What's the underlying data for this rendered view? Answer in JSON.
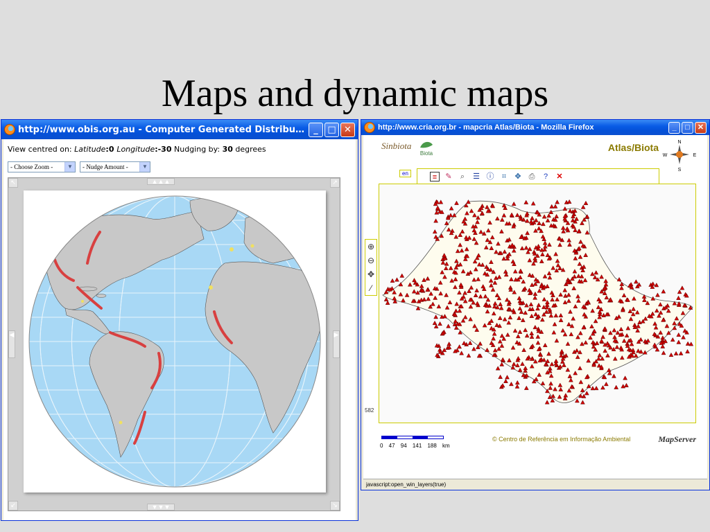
{
  "slide": {
    "title": "Maps and dynamic maps"
  },
  "window1": {
    "title": "http://www.obis.org.au - Computer Generated Distribution M...",
    "minimize": "_",
    "maximize": "□",
    "close": "✕",
    "info": {
      "prefix": "View centred on: ",
      "lat_label": "Latitude",
      "lat_value": ":0 ",
      "lon_label": "Longitude",
      "lon_value": ":-30",
      "nudge_prefix": " Nudging by: ",
      "nudge_value": "30",
      "nudge_suffix": " degrees"
    },
    "zoom_select": "- Choose Zoom -",
    "nudge_select": "- Nudge Amount -",
    "colors": {
      "ocean": "#a8d8f5",
      "land": "#c8c8c8",
      "records": "#d84040",
      "highlight": "#f0e060"
    }
  },
  "window2": {
    "title": "http://www.cria.org.br - mapcria Atlas/Biota - Mozilla Firefox",
    "minimize": "_",
    "maximize": "□",
    "close": "✕",
    "logo_text": "Sinbiota",
    "biota_logo": "Biota",
    "app_title": "Atlas/Biota",
    "compass": {
      "n": "N",
      "s": "S",
      "e": "E",
      "w": "W"
    },
    "lang": "en",
    "scale_number": "582",
    "scale_labels": "0 47 94 141 188 km",
    "copyright": "© Centro de Referência em Informação Ambiental",
    "mapserver": "MapServer",
    "status": "javascript:open_win_layers(true)",
    "colors": {
      "marker": "#cc0000",
      "state_fill": "#fefcee"
    }
  }
}
